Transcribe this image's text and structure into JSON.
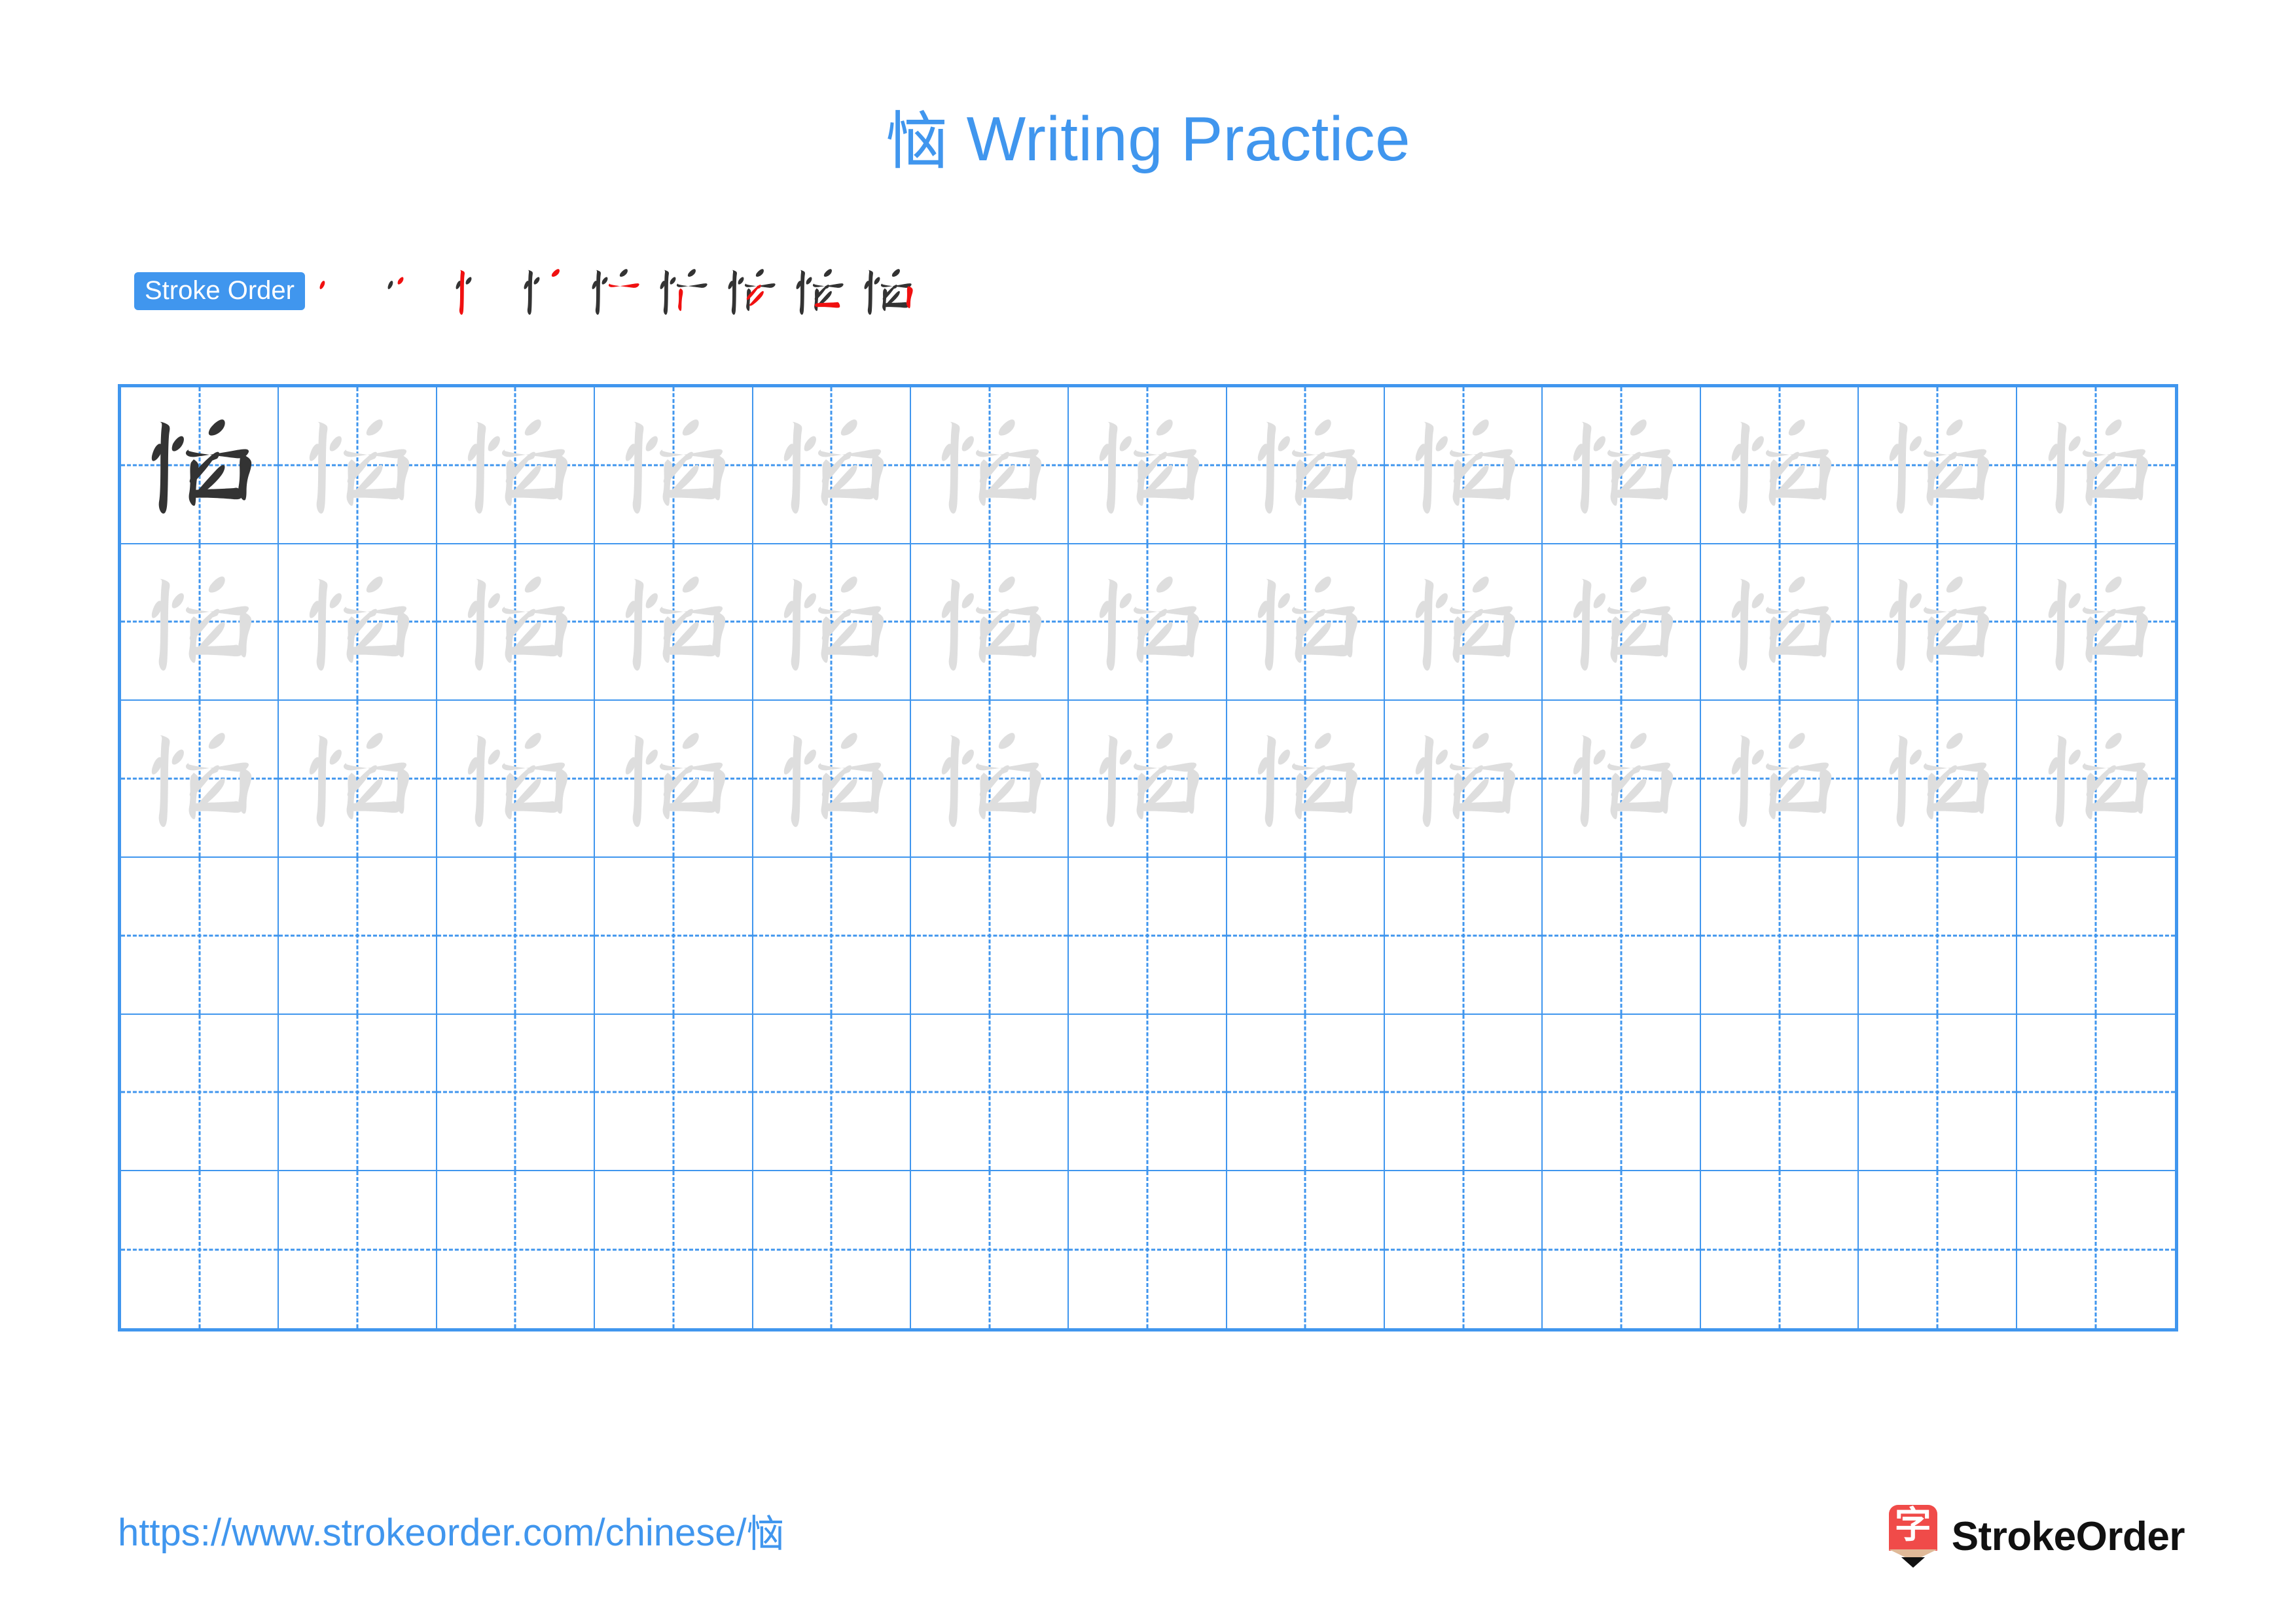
{
  "page": {
    "character": "恼",
    "title": "恼 Writing Practice",
    "title_suffix": " Writing Practice",
    "background_color": "#ffffff"
  },
  "colors": {
    "accent_blue": "#4096EE",
    "grid_line": "#4096EE",
    "ghost_char": "#DEDEDE",
    "dark_char": "#333333",
    "stroke_new": "#F01010",
    "stroke_done": "#333333",
    "logo_red": "#F04B49",
    "logo_wood": "#E0B998",
    "logo_text": "#111111"
  },
  "stroke_order": {
    "badge_label": "Stroke Order",
    "total_strokes": 9,
    "steps": [
      {
        "index": 1,
        "new_stroke": 1,
        "name": "stroke-step-1"
      },
      {
        "index": 2,
        "new_stroke": 2,
        "name": "stroke-step-2"
      },
      {
        "index": 3,
        "new_stroke": 3,
        "name": "stroke-step-3"
      },
      {
        "index": 4,
        "new_stroke": 4,
        "name": "stroke-step-4"
      },
      {
        "index": 5,
        "new_stroke": 5,
        "name": "stroke-step-5"
      },
      {
        "index": 6,
        "new_stroke": 6,
        "name": "stroke-step-6"
      },
      {
        "index": 7,
        "new_stroke": 7,
        "name": "stroke-step-7"
      },
      {
        "index": 8,
        "new_stroke": 8,
        "name": "stroke-step-8"
      },
      {
        "index": 9,
        "new_stroke": 9,
        "name": "stroke-step-9"
      }
    ]
  },
  "grid": {
    "columns": 13,
    "rows": 6,
    "cell_states": [
      [
        "dark",
        "ghost",
        "ghost",
        "ghost",
        "ghost",
        "ghost",
        "ghost",
        "ghost",
        "ghost",
        "ghost",
        "ghost",
        "ghost",
        "ghost"
      ],
      [
        "ghost",
        "ghost",
        "ghost",
        "ghost",
        "ghost",
        "ghost",
        "ghost",
        "ghost",
        "ghost",
        "ghost",
        "ghost",
        "ghost",
        "ghost"
      ],
      [
        "ghost",
        "ghost",
        "ghost",
        "ghost",
        "ghost",
        "ghost",
        "ghost",
        "ghost",
        "ghost",
        "ghost",
        "ghost",
        "ghost",
        "ghost"
      ],
      [
        "empty",
        "empty",
        "empty",
        "empty",
        "empty",
        "empty",
        "empty",
        "empty",
        "empty",
        "empty",
        "empty",
        "empty",
        "empty"
      ],
      [
        "empty",
        "empty",
        "empty",
        "empty",
        "empty",
        "empty",
        "empty",
        "empty",
        "empty",
        "empty",
        "empty",
        "empty",
        "empty"
      ],
      [
        "empty",
        "empty",
        "empty",
        "empty",
        "empty",
        "empty",
        "empty",
        "empty",
        "empty",
        "empty",
        "empty",
        "empty",
        "empty"
      ]
    ]
  },
  "footer": {
    "url_prefix": "https://www.strokeorder.com/chinese/",
    "url_char": "恼",
    "url_full": "https://www.strokeorder.com/chinese/恼",
    "brand_glyph": "字",
    "brand_name": "StrokeOrder"
  }
}
